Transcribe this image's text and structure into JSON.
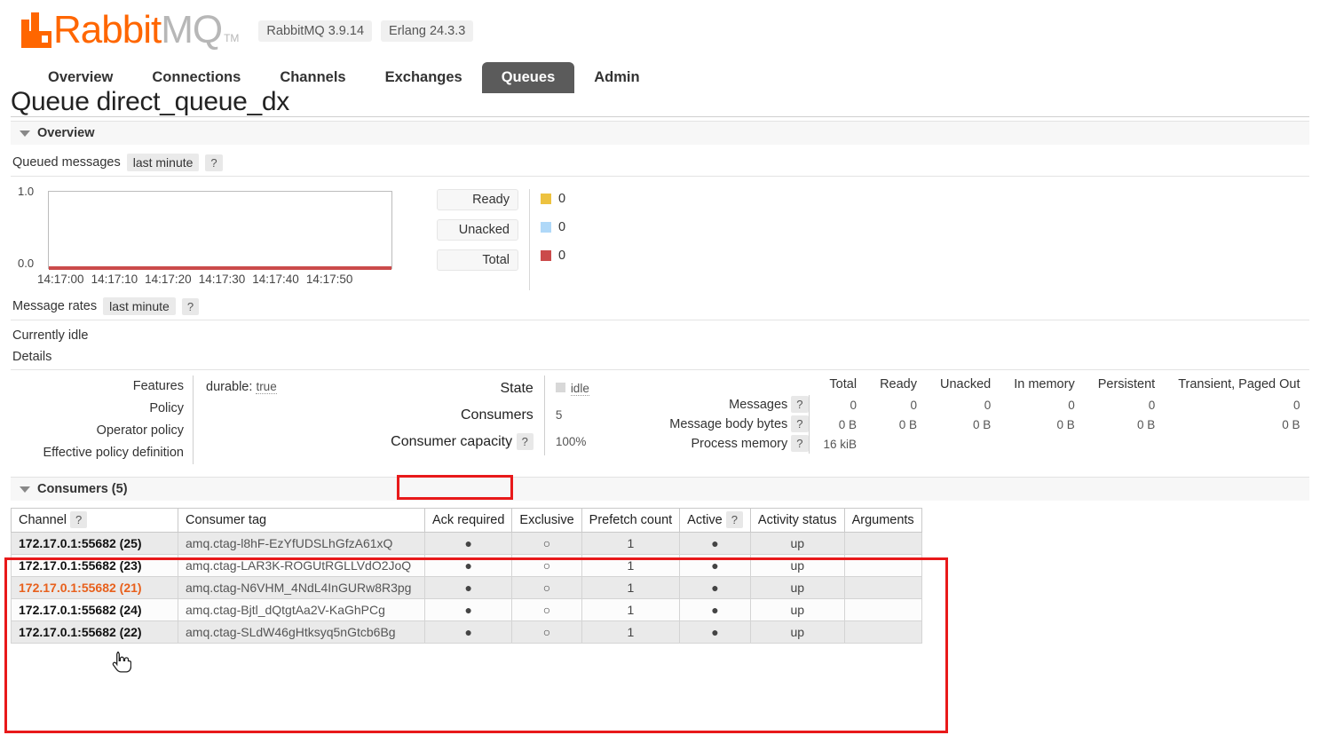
{
  "header": {
    "logo_text_primary": "Rabbit",
    "logo_text_secondary": "MQ",
    "logo_tm": "TM",
    "version_badges": [
      "RabbitMQ 3.9.14",
      "Erlang 24.3.3"
    ],
    "nav": [
      {
        "label": "Overview",
        "active": false
      },
      {
        "label": "Connections",
        "active": false
      },
      {
        "label": "Channels",
        "active": false
      },
      {
        "label": "Exchanges",
        "active": false
      },
      {
        "label": "Queues",
        "active": true
      },
      {
        "label": "Admin",
        "active": false
      }
    ]
  },
  "page": {
    "title_prefix": "Queue",
    "queue_name": "direct_queue_dx"
  },
  "overview": {
    "section_label": "Overview",
    "queued_messages_label": "Queued messages",
    "queued_messages_period": "last minute",
    "help": "?"
  },
  "chart_data": {
    "type": "line",
    "title": "Queued messages",
    "subtitle": "last minute",
    "x": [
      "14:17:00",
      "14:17:10",
      "14:17:20",
      "14:17:30",
      "14:17:40",
      "14:17:50"
    ],
    "xlabel": "",
    "ylabel": "",
    "ylim": [
      0.0,
      1.0
    ],
    "ytick_labels": [
      "1.0",
      "0.0"
    ],
    "grid": false,
    "legend_position": "right",
    "series": [
      {
        "name": "Ready",
        "value": "0",
        "color": "#edc240",
        "values": [
          0,
          0,
          0,
          0,
          0,
          0
        ]
      },
      {
        "name": "Unacked",
        "value": "0",
        "color": "#afd8f8",
        "values": [
          0,
          0,
          0,
          0,
          0,
          0
        ]
      },
      {
        "name": "Total",
        "value": "0",
        "color": "#cb4b4b",
        "values": [
          0,
          0,
          0,
          0,
          0,
          0
        ]
      }
    ]
  },
  "message_rates": {
    "label": "Message rates",
    "period": "last minute",
    "help": "?",
    "status": "Currently idle"
  },
  "details": {
    "label": "Details",
    "left_labels": [
      "Features",
      "Policy",
      "Operator policy",
      "Effective policy definition"
    ],
    "features_key": "durable:",
    "features_value": "true",
    "state_label": "State",
    "state_value": "idle",
    "consumers_label": "Consumers",
    "consumers_value": "5",
    "consumer_capacity_label": "Consumer capacity",
    "consumer_capacity_help": "?",
    "consumer_capacity_value": "100%"
  },
  "messages_table": {
    "columns": [
      "Total",
      "Ready",
      "Unacked",
      "In memory",
      "Persistent",
      "Transient, Paged Out"
    ],
    "rows": [
      {
        "label": "Messages",
        "help": "?",
        "values": [
          "0",
          "0",
          "0",
          "0",
          "0",
          "0"
        ]
      },
      {
        "label": "Message body bytes",
        "help": "?",
        "values": [
          "0 B",
          "0 B",
          "0 B",
          "0 B",
          "0 B",
          "0 B"
        ]
      },
      {
        "label": "Process memory",
        "help": "?",
        "values": [
          "16 kiB",
          "",
          "",
          "",
          "",
          ""
        ]
      }
    ]
  },
  "consumers": {
    "section_label": "Consumers (5)",
    "columns": [
      "Channel",
      "Consumer tag",
      "Ack required",
      "Exclusive",
      "Prefetch count",
      "Active",
      "Activity status",
      "Arguments"
    ],
    "channel_help": "?",
    "active_help": "?",
    "rows": [
      {
        "channel": "172.17.0.1:55682 (25)",
        "tag": "amq.ctag-l8hF-EzYfUDSLhGfzA61xQ",
        "ack_required": "●",
        "exclusive": "○",
        "prefetch_count": "1",
        "active": "●",
        "activity_status": "up",
        "arguments": "",
        "highlighted": false
      },
      {
        "channel": "172.17.0.1:55682 (23)",
        "tag": "amq.ctag-LAR3K-ROGUtRGLLVdO2JoQ",
        "ack_required": "●",
        "exclusive": "○",
        "prefetch_count": "1",
        "active": "●",
        "activity_status": "up",
        "arguments": "",
        "highlighted": false
      },
      {
        "channel": "172.17.0.1:55682 (21)",
        "tag": "amq.ctag-N6VHM_4NdL4InGURw8R3pg",
        "ack_required": "●",
        "exclusive": "○",
        "prefetch_count": "1",
        "active": "●",
        "activity_status": "up",
        "arguments": "",
        "highlighted": true
      },
      {
        "channel": "172.17.0.1:55682 (24)",
        "tag": "amq.ctag-Bjtl_dQtgtAa2V-KaGhPCg",
        "ack_required": "●",
        "exclusive": "○",
        "prefetch_count": "1",
        "active": "●",
        "activity_status": "up",
        "arguments": "",
        "highlighted": false
      },
      {
        "channel": "172.17.0.1:55682 (22)",
        "tag": "amq.ctag-SLdW46gHtksyq5nGtcb6Bg",
        "ack_required": "●",
        "exclusive": "○",
        "prefetch_count": "1",
        "active": "●",
        "activity_status": "up",
        "arguments": "",
        "highlighted": false
      }
    ]
  },
  "annotations": {
    "highlight_color": "#e8191a"
  }
}
